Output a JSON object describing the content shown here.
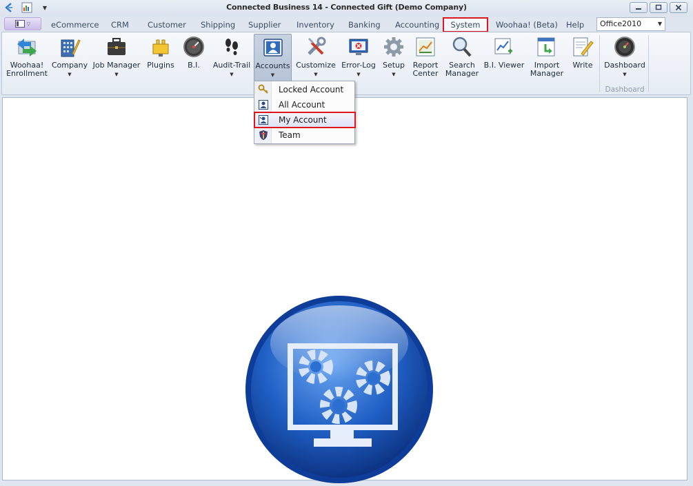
{
  "window": {
    "title": "Connected Business 14 - Connected Gift (Demo Company)",
    "controls": [
      "minimize",
      "maximize",
      "close"
    ]
  },
  "tabs": [
    {
      "label": "eCommerce"
    },
    {
      "label": "CRM"
    },
    {
      "label": "Customer"
    },
    {
      "label": "Shipping"
    },
    {
      "label": "Supplier"
    },
    {
      "label": "Inventory"
    },
    {
      "label": "Banking"
    },
    {
      "label": "Accounting"
    },
    {
      "label": "System",
      "active": true
    },
    {
      "label": "Woohaa! (Beta)"
    },
    {
      "label": "Help"
    }
  ],
  "theme_selector": {
    "value": "Office2010"
  },
  "ribbon": {
    "buttons": [
      {
        "label": "Woohaa!\nEnrollment",
        "icon": "enrollment-arrows-icon"
      },
      {
        "label": "Company",
        "icon": "company-building-icon",
        "dropdown": true
      },
      {
        "label": "Job Manager",
        "icon": "briefcase-icon",
        "dropdown": true
      },
      {
        "label": "Plugins",
        "icon": "plugin-icon"
      },
      {
        "label": "B.I.",
        "icon": "gauge-icon"
      },
      {
        "label": "Audit-Trail",
        "icon": "footprints-icon",
        "dropdown": true
      },
      {
        "label": "Accounts",
        "icon": "user-account-icon",
        "dropdown": true,
        "pressed": true
      },
      {
        "label": "Customize",
        "icon": "tools-icon",
        "dropdown": true
      },
      {
        "label": "Error-Log",
        "icon": "error-monitor-icon",
        "dropdown": true
      },
      {
        "label": "Setup",
        "icon": "gear-icon",
        "dropdown": true
      },
      {
        "label": "Report\nCenter",
        "icon": "report-chart-icon"
      },
      {
        "label": "Search\nManager",
        "icon": "magnifier-icon"
      },
      {
        "label": "B.I. Viewer",
        "icon": "bi-viewer-icon"
      },
      {
        "label": "Import\nManager",
        "icon": "import-icon"
      },
      {
        "label": "Write",
        "icon": "write-pencil-icon"
      },
      {
        "label": "Dashboard",
        "icon": "dashboard-gauge-icon",
        "dropdown": true
      }
    ],
    "group_label": "Dashboard"
  },
  "accounts_menu": {
    "items": [
      {
        "label": "Locked Account",
        "icon": "keys-icon"
      },
      {
        "label": "All Account",
        "icon": "user-card-icon"
      },
      {
        "label": "My Account",
        "icon": "user-card-check-icon",
        "highlighted": true
      },
      {
        "label": "Team",
        "icon": "team-shield-icon"
      }
    ]
  },
  "colors": {
    "highlight_border": "#e0161e",
    "ribbon_bg": "#e6ecf4",
    "hero_blue": "#1f5fc4"
  }
}
